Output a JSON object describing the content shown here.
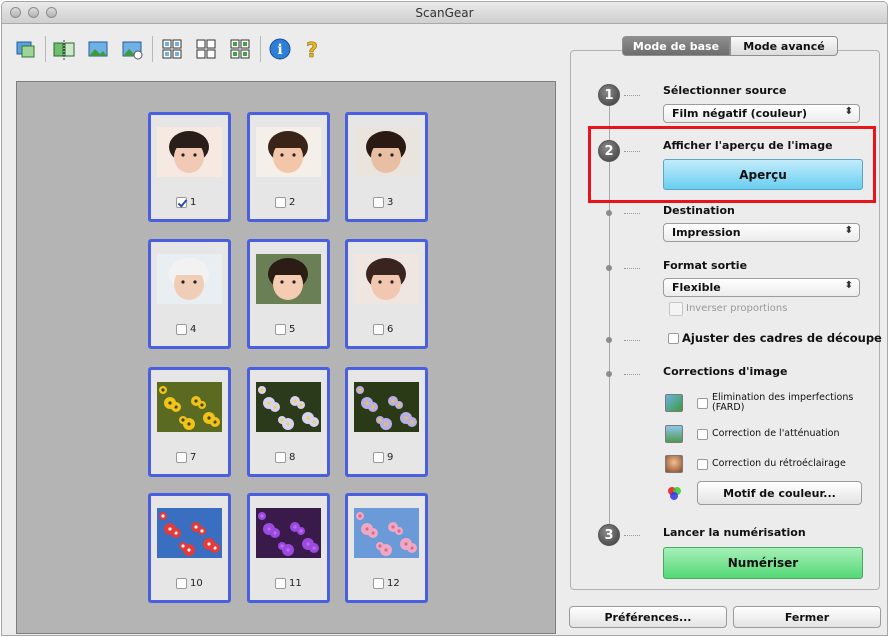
{
  "window": {
    "title": "ScanGear"
  },
  "toolbar": {
    "icons": [
      "rotate-icon",
      "mirror-icon",
      "crop-preview-icon",
      "clear-crop-icon",
      "view-all-icon",
      "view-grid-icon",
      "select-all-icon",
      "info-icon",
      "help-icon"
    ]
  },
  "frames": [
    {
      "n": "1",
      "checked": true,
      "kind": "face"
    },
    {
      "n": "2",
      "checked": false,
      "kind": "face"
    },
    {
      "n": "3",
      "checked": false,
      "kind": "face"
    },
    {
      "n": "4",
      "checked": false,
      "kind": "face"
    },
    {
      "n": "5",
      "checked": false,
      "kind": "face"
    },
    {
      "n": "6",
      "checked": false,
      "kind": "face"
    },
    {
      "n": "7",
      "checked": false,
      "kind": "flower"
    },
    {
      "n": "8",
      "checked": false,
      "kind": "flower"
    },
    {
      "n": "9",
      "checked": false,
      "kind": "flower"
    },
    {
      "n": "10",
      "checked": false,
      "kind": "flower"
    },
    {
      "n": "11",
      "checked": false,
      "kind": "flower"
    },
    {
      "n": "12",
      "checked": false,
      "kind": "flower"
    }
  ],
  "tabs": {
    "basic": "Mode de base",
    "advanced": "Mode avancé"
  },
  "steps": {
    "one": "1",
    "two": "2",
    "three": "3",
    "select_source": "Sélectionner source",
    "source_value": "Film négatif (couleur)",
    "preview_label": "Afficher l'aperçu de l'image",
    "preview_button": "Aperçu",
    "destination": "Destination",
    "destination_value": "Impression",
    "output_size": "Format sortie",
    "output_value": "Flexible",
    "invert_ratio": "Inverser proportions",
    "adjust_crop": "Ajuster des cadres de découpe",
    "corrections": "Corrections d'image",
    "fard_1": "Elimination des imperfections",
    "fard_2": "(FARD)",
    "fading": "Correction de l'atténuation",
    "backlight": "Correction du rétroéclairage",
    "color_pattern": "Motif de couleur...",
    "start_scan": "Lancer la numérisation",
    "scan_button": "Numériser"
  },
  "footer": {
    "preferences": "Préférences...",
    "close": "Fermer"
  }
}
